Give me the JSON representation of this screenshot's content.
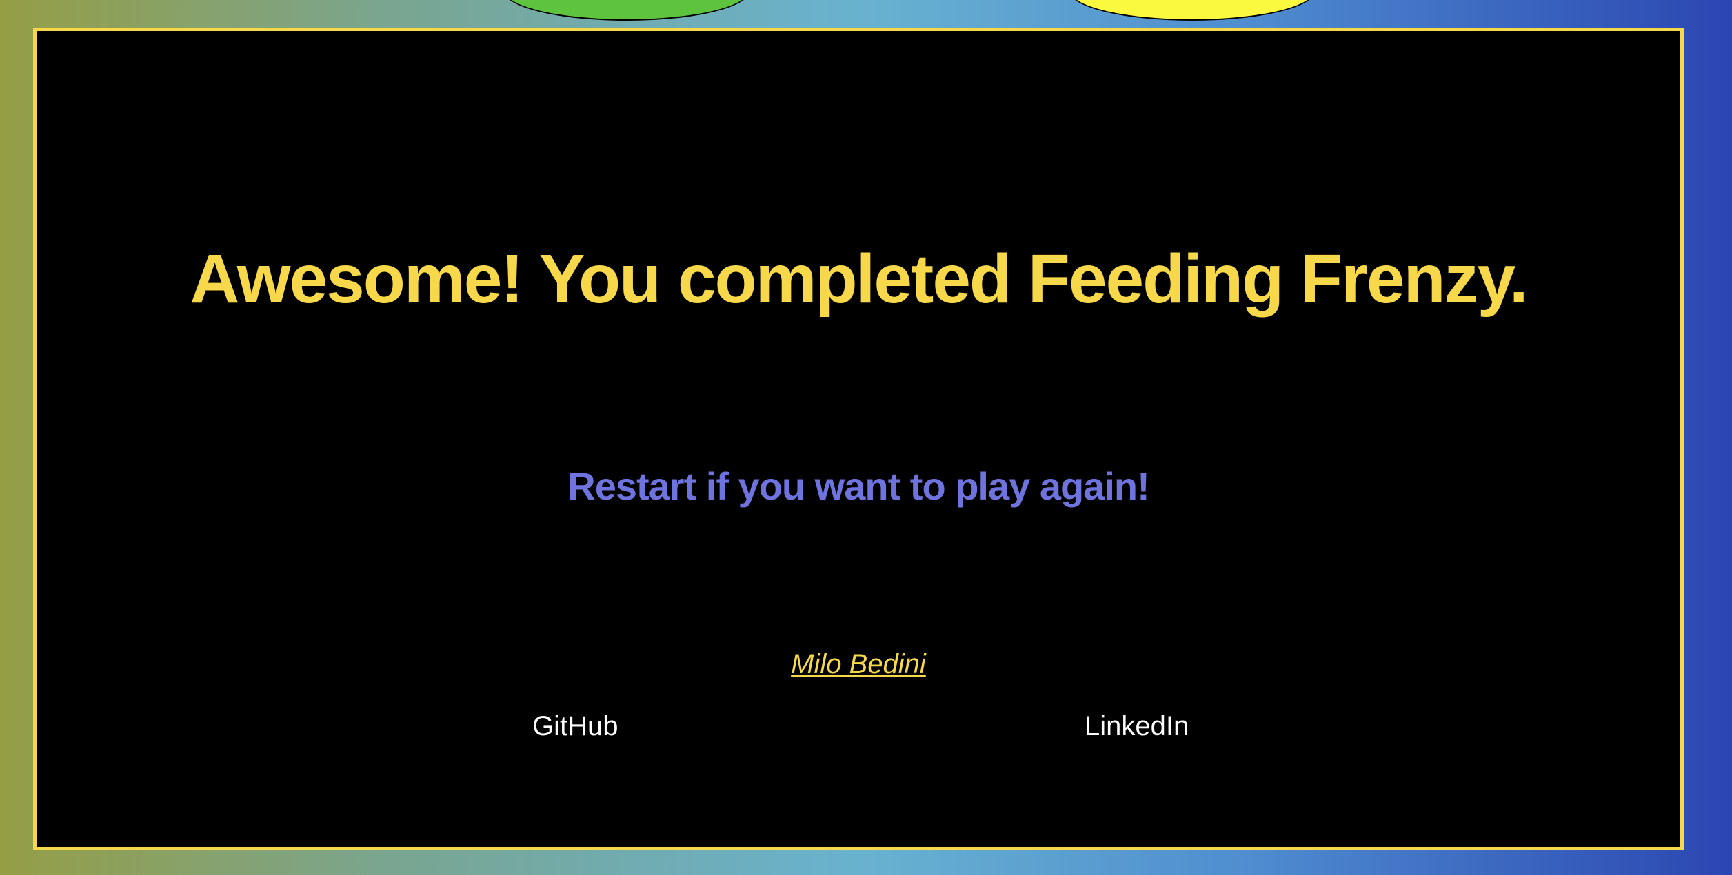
{
  "colors": {
    "accent": "#f6d84a",
    "subtitle": "#6e73de",
    "panel_background": "#000000",
    "link": "#ffffff"
  },
  "end_screen": {
    "headline": "Awesome! You completed Feeding Frenzy.",
    "subheadline": "Restart if you want to play again!"
  },
  "footer": {
    "author": "Milo Bedini",
    "links": [
      {
        "label": "GitHub"
      },
      {
        "label": "LinkedIn"
      }
    ]
  }
}
